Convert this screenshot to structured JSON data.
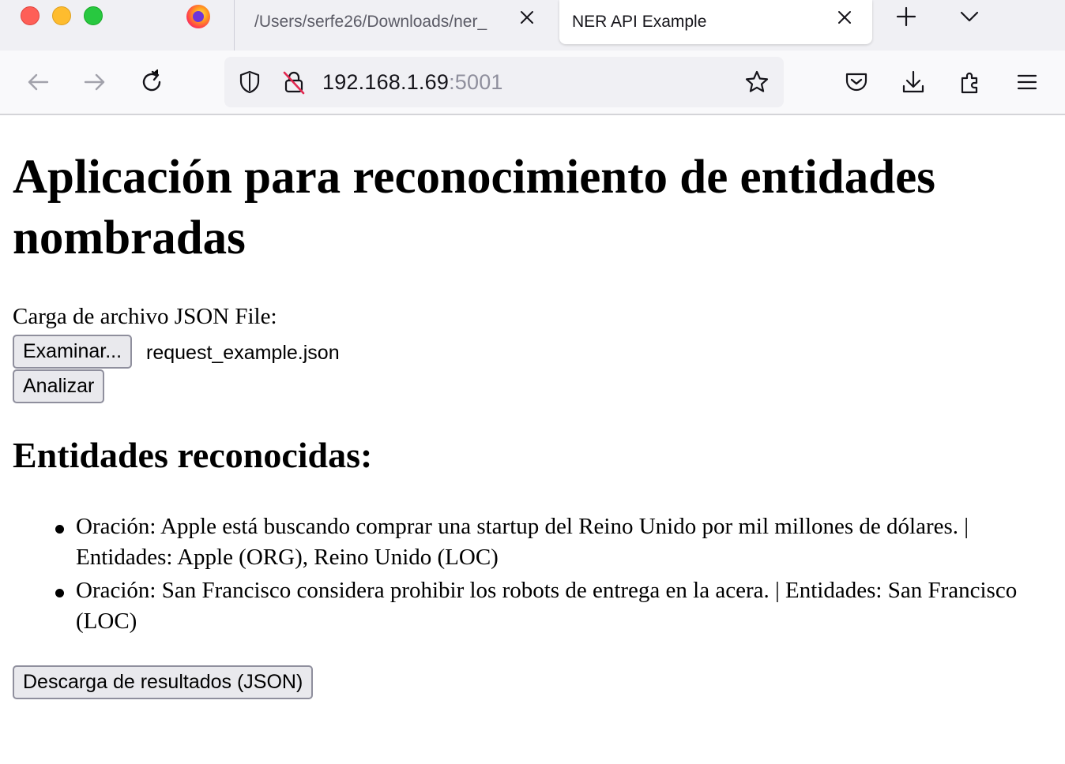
{
  "browser": {
    "tabs": [
      {
        "title": "/Users/serfe26/Downloads/ner_",
        "active": false
      },
      {
        "title": "NER API Example",
        "active": true
      }
    ],
    "url": {
      "host": "192.168.1.69",
      "port": ":5001"
    },
    "icons": {
      "firefox_tab": "firefox-icon",
      "back": "arrow-left-icon",
      "forward": "arrow-right-icon",
      "reload": "reload-icon",
      "shield": "tracking-shield-icon",
      "insecure": "insecure-lock-icon",
      "bookmark": "star-icon",
      "pocket": "pocket-icon",
      "downloads": "download-icon",
      "extensions": "extensions-icon",
      "menu": "hamburger-menu-icon"
    },
    "colors": {
      "traffic_red": "#fe5f57",
      "traffic_yellow": "#febc2e",
      "traffic_green": "#28c840"
    }
  },
  "page": {
    "title": "Aplicación para reconocimiento de entidades nombradas",
    "upload_label": "Carga de archivo JSON File:",
    "browse_button": "Examinar...",
    "selected_file": "request_example.json",
    "analyze_button": "Analizar",
    "results_heading": "Entidades reconocidas:",
    "results": [
      "Oración: Apple está buscando comprar una startup del Reino Unido por mil millones de dólares. | Entidades: Apple (ORG), Reino Unido (LOC)",
      "Oración: San Francisco considera prohibir los robots de entrega en la acera. | Entidades: San Francisco (LOC)"
    ],
    "download_button": "Descarga de resultados (JSON)"
  }
}
